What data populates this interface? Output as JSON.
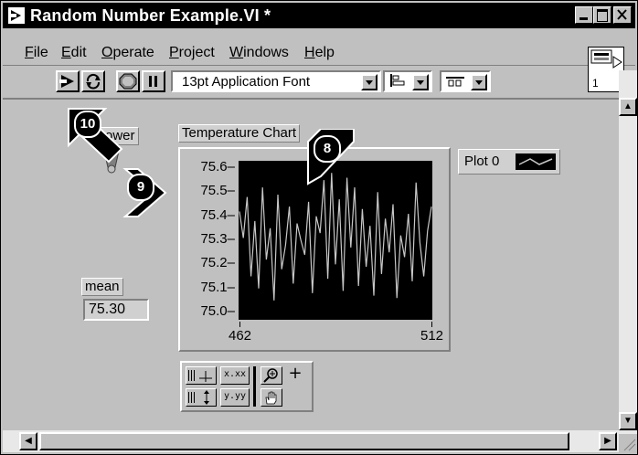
{
  "window": {
    "title": "Random Number Example.VI *"
  },
  "menu": {
    "items": [
      {
        "label": "File",
        "u": "F",
        "rest": "ile"
      },
      {
        "label": "Edit",
        "u": "E",
        "rest": "dit"
      },
      {
        "label": "Operate",
        "u": "O",
        "rest": "perate"
      },
      {
        "label": "Project",
        "u": "P",
        "rest": "roject"
      },
      {
        "label": "Windows",
        "u": "W",
        "rest": "indows"
      },
      {
        "label": "Help",
        "u": "H",
        "rest": "elp"
      }
    ]
  },
  "toolbar": {
    "font": "13pt Application Font",
    "icons": [
      "run-icon",
      "run-continuously-icon",
      "abort-icon",
      "pause-icon",
      "text-align-icon",
      "distribute-icon"
    ]
  },
  "connector": {
    "number": "1"
  },
  "panel": {
    "power_label": "Power",
    "mean_label": "mean",
    "mean_value": "75.30",
    "chart_label": "Temperature Chart",
    "legend_label": "Plot 0"
  },
  "callouts": [
    "10",
    "9",
    "8"
  ],
  "palette": {
    "x_format": "x.xx",
    "y_format": "y.yy"
  },
  "chart_data": {
    "type": "line",
    "title": "Temperature Chart",
    "x": [
      462,
      463,
      464,
      465,
      466,
      467,
      468,
      469,
      470,
      471,
      472,
      473,
      474,
      475,
      476,
      477,
      478,
      479,
      480,
      481,
      482,
      483,
      484,
      485,
      486,
      487,
      488,
      489,
      490,
      491,
      492,
      493,
      494,
      495,
      496,
      497,
      498,
      499,
      500,
      501,
      502,
      503,
      504,
      505,
      506,
      507,
      508,
      509,
      510,
      511,
      512
    ],
    "series": [
      {
        "name": "Plot 0",
        "values": [
          75.42,
          75.31,
          75.48,
          75.15,
          75.38,
          75.1,
          75.52,
          75.22,
          75.35,
          75.05,
          75.49,
          75.18,
          75.28,
          75.44,
          75.12,
          75.37,
          75.3,
          75.24,
          75.46,
          75.08,
          75.4,
          75.33,
          75.55,
          75.14,
          75.58,
          75.2,
          75.47,
          75.09,
          75.56,
          75.27,
          75.52,
          75.11,
          75.43,
          75.19,
          75.36,
          75.07,
          75.5,
          75.16,
          75.39,
          75.25,
          75.45,
          75.06,
          75.32,
          75.23,
          75.41,
          75.13,
          75.54,
          75.29,
          75.15,
          75.34,
          75.44
        ]
      }
    ],
    "ylim": [
      75.0,
      75.6
    ],
    "yticks": [
      "75.6",
      "75.5",
      "75.4",
      "75.3",
      "75.2",
      "75.1",
      "75.0"
    ],
    "xticks": [
      "462",
      "512"
    ],
    "xlim": [
      462,
      512
    ],
    "legend": "top-right",
    "grid": false,
    "line_color": "#c8c8c8",
    "background": "#000000"
  }
}
